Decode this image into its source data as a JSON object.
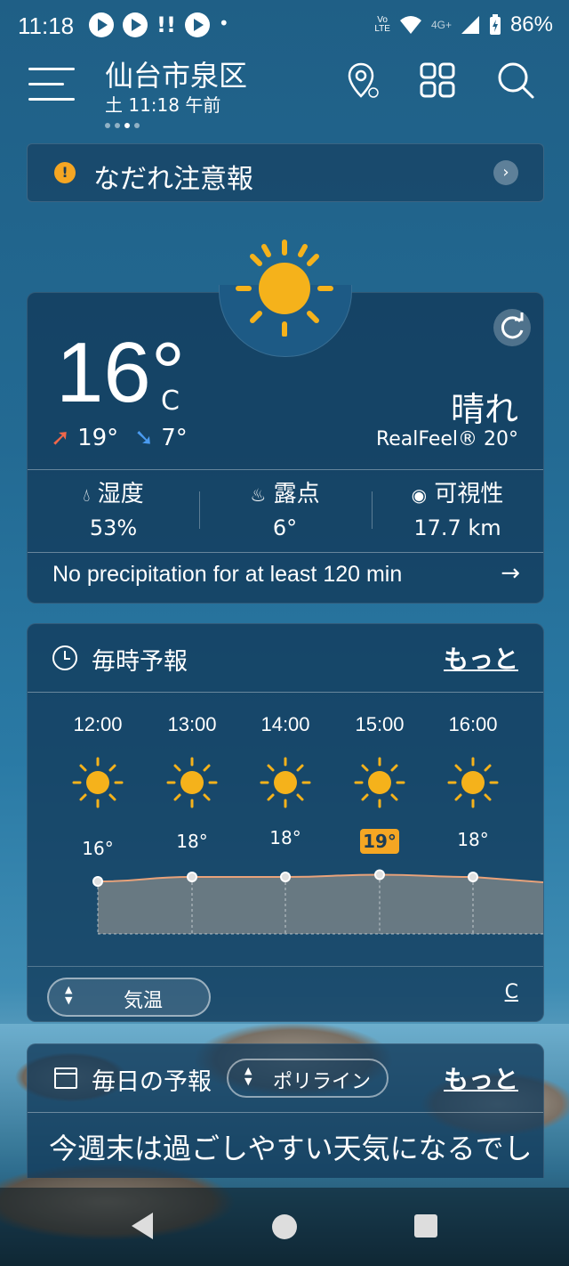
{
  "status_bar": {
    "time": "11:18",
    "network_badge_top": "Vo",
    "network_badge_bottom": "LTE",
    "network_type": "4G+",
    "battery": "86%"
  },
  "header": {
    "location": "仙台市泉区",
    "subtitle": "土 11:18 午前"
  },
  "alert": {
    "text": "なだれ注意報"
  },
  "current": {
    "temperature": "16°",
    "unit": "C",
    "high": "19°",
    "low": "7°",
    "condition": "晴れ",
    "realfeel": "RealFeel® 20°",
    "humidity_label": "湿度",
    "humidity_value": "53%",
    "dewpoint_label": "露点",
    "dewpoint_value": "6°",
    "visibility_label": "可視性",
    "visibility_value": "17.7 km",
    "precip_text": "No precipitation for at least 120 min"
  },
  "hourly": {
    "title": "毎時予報",
    "more": "もっと",
    "items": [
      {
        "time": "12:00",
        "temp": "16°"
      },
      {
        "time": "13:00",
        "temp": "18°"
      },
      {
        "time": "14:00",
        "temp": "18°"
      },
      {
        "time": "15:00",
        "temp": "19°"
      },
      {
        "time": "16:00",
        "temp": "18°"
      }
    ],
    "selected_index": 3,
    "metric_selector": "気温",
    "unit_link": "C"
  },
  "daily": {
    "title": "毎日の予報",
    "selector": "ポリライン",
    "more": "もっと",
    "headline": "今週末は過ごしやすい天気になるでし"
  },
  "colors": {
    "accent": "#f5a623",
    "sun": "#f5b21b",
    "card_bg": "#123a5a"
  }
}
